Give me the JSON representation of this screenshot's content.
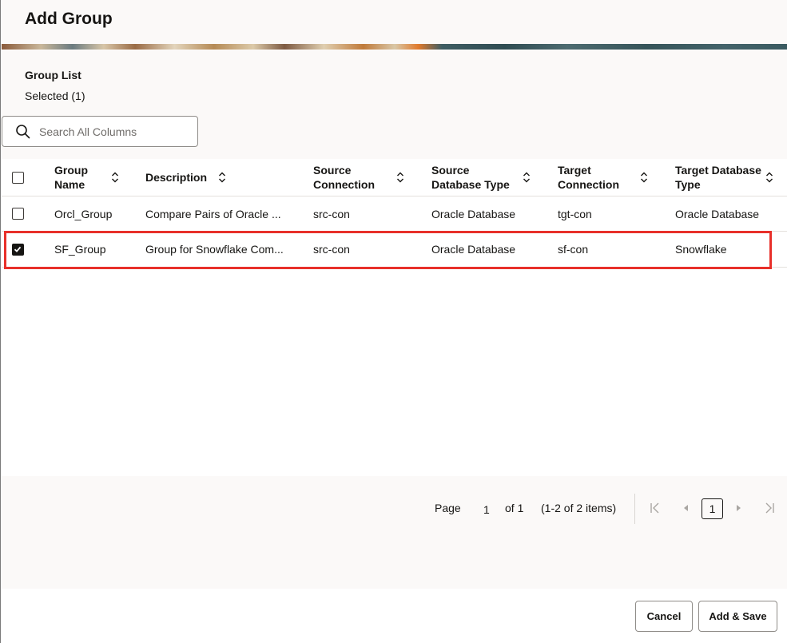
{
  "dialog": {
    "title": "Add Group"
  },
  "group_list": {
    "title": "Group List",
    "selected_label": "Selected (1)"
  },
  "search": {
    "placeholder": "Search All Columns",
    "value": ""
  },
  "table": {
    "columns": [
      "Group Name",
      "Description",
      "Source Connection",
      "Source Database Type",
      "Target Connection",
      "Target Database Type"
    ],
    "rows": [
      {
        "checked": false,
        "group_name": "Orcl_Group",
        "description": "Compare Pairs of Oracle ...",
        "source_connection": "src-con",
        "source_db_type": "Oracle Database",
        "target_connection": "tgt-con",
        "target_db_type": "Oracle Database"
      },
      {
        "checked": true,
        "group_name": "SF_Group",
        "description": "Group for Snowflake Com...",
        "source_connection": "src-con",
        "source_db_type": "Oracle Database",
        "target_connection": "sf-con",
        "target_db_type": "Snowflake"
      }
    ]
  },
  "pagination": {
    "page_label": "Page",
    "page_value": "1",
    "of_label": "of 1",
    "items_label": "(1-2 of 2 items)",
    "current_page": "1"
  },
  "footer": {
    "cancel_label": "Cancel",
    "save_label": "Add & Save"
  },
  "colors": {
    "highlight": "#e8302a",
    "background": "#fbf9f8"
  }
}
